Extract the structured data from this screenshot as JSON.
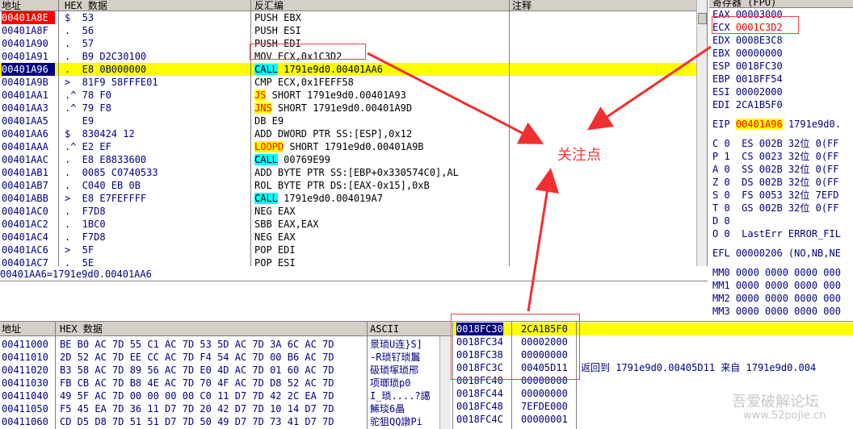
{
  "disasm": {
    "headers": [
      "地址",
      "HEX 数据",
      "反汇编",
      "注释"
    ],
    "rows": [
      {
        "addr": "00401A8E",
        "hex": "$  53",
        "asm": "PUSH EBX",
        "style": "red"
      },
      {
        "addr": "00401A8F",
        "hex": ".  56",
        "asm": "PUSH ESI"
      },
      {
        "addr": "00401A90",
        "hex": ".  57",
        "asm": "PUSH EDI"
      },
      {
        "addr": "00401A91",
        "hex": ".  B9 D2C30100",
        "asm": "MOV ECX,0x1C3D2"
      },
      {
        "addr": "00401A96",
        "hex": ".  E8 0B000000",
        "mn": "CALL",
        "mnStyle": "call",
        "rest": " 1791e9d0.00401AA6",
        "style": "sel"
      },
      {
        "addr": "00401A9B",
        "hex": ">  81F9 58FFFE01",
        "asm": "CMP ECX,0x1FEFF58"
      },
      {
        "addr": "00401AA1",
        "hex": ".^ 78 F0",
        "mn": "JS",
        "mnStyle": "j",
        "rest": " SHORT 1791e9d0.00401A93"
      },
      {
        "addr": "00401AA3",
        "hex": ".^ 79 F8",
        "mn": "JNS",
        "mnStyle": "j",
        "rest": " SHORT 1791e9d0.00401A9D"
      },
      {
        "addr": "00401AA5",
        "hex": "   E9",
        "asm": "DB E9"
      },
      {
        "addr": "00401AA6",
        "hex": "$  830424 12",
        "asm": "ADD DWORD PTR SS:[ESP],0x12"
      },
      {
        "addr": "00401AAA",
        "hex": ".^ E2 EF",
        "mn": "LOOPD",
        "mnStyle": "j",
        "rest": " SHORT 1791e9d0.00401A9B"
      },
      {
        "addr": "00401AAC",
        "hex": ".  E8 E8833600",
        "mn": "CALL",
        "mnStyle": "call",
        "rest": " 00769E99"
      },
      {
        "addr": "00401AB1",
        "hex": ".  0085 C0740533",
        "asm": "ADD BYTE PTR SS:[EBP+0x330574C0],AL"
      },
      {
        "addr": "00401AB7",
        "hex": ".  C040 EB 0B",
        "asm": "ROL BYTE PTR DS:[EAX-0x15],0xB"
      },
      {
        "addr": "00401ABB",
        "hex": ">  E8 E7FEFFFF",
        "mn": "CALL",
        "mnStyle": "call",
        "rest": " 1791e9d0.004019A7"
      },
      {
        "addr": "00401AC0",
        "hex": ".  F7D8",
        "asm": "NEG EAX"
      },
      {
        "addr": "00401AC2",
        "hex": ".  1BC0",
        "asm": "SBB EAX,EAX"
      },
      {
        "addr": "00401AC4",
        "hex": ".  F7D8",
        "asm": "NEG EAX"
      },
      {
        "addr": "00401AC6",
        "hex": ">  5F",
        "asm": "POP EDI"
      },
      {
        "addr": "00401AC7",
        "hex": ".  5E",
        "asm": "POP ESI"
      }
    ]
  },
  "info_line": "00401AA6=1791e9d0.00401AA6",
  "registers": {
    "header": "寄存器 (FPU)",
    "rows": [
      {
        "name": "EAX",
        "value": "00003000"
      },
      {
        "name": "ECX",
        "value": "0001C3D2",
        "style": "red"
      },
      {
        "name": "EDX",
        "value": "0008E3C8"
      },
      {
        "name": "EBX",
        "value": "00000000"
      },
      {
        "name": "ESP",
        "value": "0018FC30"
      },
      {
        "name": "EBP",
        "value": "0018FF54"
      },
      {
        "name": "ESI",
        "value": "00002000"
      },
      {
        "name": "EDI",
        "value": "2CA1B5F0"
      }
    ],
    "eip": {
      "name": "EIP",
      "value": "00401A96",
      "extra": "1791e9d0."
    },
    "flags": [
      "C 0  ES 002B 32位 0(FF",
      "P 1  CS 0023 32位 0(FF",
      "A 0  SS 002B 32位 0(FF",
      "Z 0  DS 002B 32位 0(FF",
      "S 0  FS 0053 32位 7EFD",
      "T 0  GS 002B 32位 0(FF",
      "D 0",
      "O 0  LastErr ERROR_FIL"
    ],
    "efl": "EFL 00000206 (NO,NB,NE",
    "mm": [
      "MM0 0000 0000 0000 000",
      "MM1 0000 0000 0000 000",
      "MM2 0000 0000 0000 000",
      "MM3 0000 0000 0000 000"
    ]
  },
  "dump": {
    "headers": [
      "地址",
      "HEX 数据",
      "ASCII"
    ],
    "rows": [
      {
        "addr": "00411000",
        "hex": "BE B0 AC 7D 55 C1 AC 7D 53 5D AC 7D 3A 6C AC 7D",
        "ascii": "景琐U连}S]"
      },
      {
        "addr": "00411010",
        "hex": "2D 52 AC 7D EE CC AC 7D F4 54 AC 7D 00 B6 AC 7D",
        "ascii": "-R琐钌琐鬞"
      },
      {
        "addr": "00411020",
        "hex": "B3 58 AC 7D 89 56 AC 7D E0 4D AC 7D 01 60 AC 7D",
        "ascii": "砐琐塚琐郉"
      },
      {
        "addr": "00411030",
        "hex": "FB CB AC 7D B8 4E AC 7D 70 4F AC 7D D8 52 AC 7D",
        "ascii": "项瑯琐p0"
      },
      {
        "addr": "00411040",
        "hex": "49 5F AC 7D 00 00 00 00 C0 11 D7 7D 42 2C EA 7D",
        "ascii": "I_琐....?譪"
      },
      {
        "addr": "00411050",
        "hex": "F5 45 EA 7D 36 11 D7 7D 20 42 D7 7D 10 14 D7 7D",
        "ascii": "鯑琰6瞐"
      },
      {
        "addr": "00411060",
        "hex": "CD D5 D8 7D 51 51 D7 7D 50 49 D7 7D 73 41 D7 7D",
        "ascii": "驼狙QQ譈Pi"
      }
    ]
  },
  "stack": {
    "rows": [
      {
        "addr": "0018FC30",
        "value": "2CA1B5F0",
        "comment": "",
        "style": "sel"
      },
      {
        "addr": "0018FC34",
        "value": "00002000",
        "comment": ""
      },
      {
        "addr": "0018FC38",
        "value": "00000000",
        "comment": ""
      },
      {
        "addr": "0018FC3C",
        "value": "00405D11",
        "comment": "返回到 1791e9d0.00405D11 来自 1791e9d0.004"
      },
      {
        "addr": "0018FC40",
        "value": "00000000",
        "comment": ""
      },
      {
        "addr": "0018FC44",
        "value": "00000000",
        "comment": ""
      },
      {
        "addr": "0018FC48",
        "value": "7EFDE000",
        "comment": ""
      },
      {
        "addr": "0018FC4C",
        "value": "00000001",
        "comment": ""
      }
    ]
  },
  "annotation": {
    "label": "关注点"
  },
  "watermark": {
    "line1": "吾爱破解论坛",
    "line2": "www.52pojie.cn"
  },
  "colors": {
    "accent": "#ff3030",
    "selection": "#000080",
    "highlight": "#ffff00",
    "call": "#00ffff"
  }
}
